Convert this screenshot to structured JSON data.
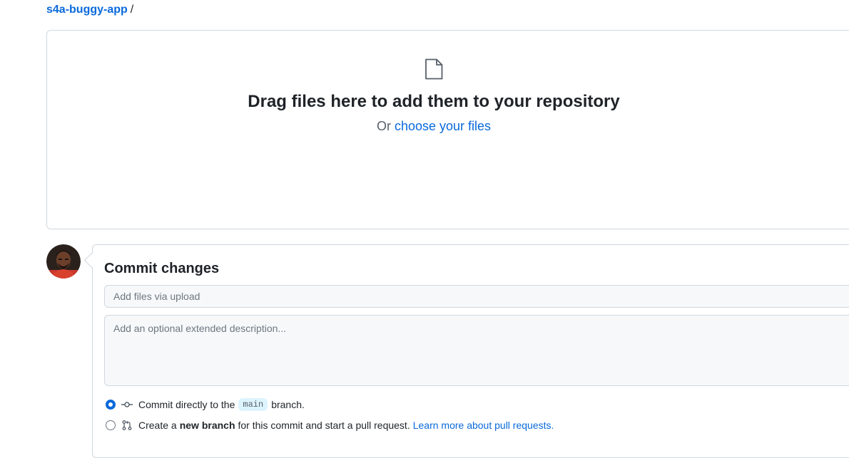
{
  "breadcrumb": {
    "repo": "s4a-buggy-app",
    "separator": "/"
  },
  "dropzone": {
    "title": "Drag files here to add them to your repository",
    "or_text": "Or",
    "choose_link": "choose your files"
  },
  "commit": {
    "title": "Commit changes",
    "summary_placeholder": "Add files via upload",
    "summary_value": "",
    "description_placeholder": "Add an optional extended description...",
    "description_value": "",
    "options": [
      {
        "selected": true,
        "text_before": "Commit directly to the",
        "branch": "main",
        "text_after": "branch."
      },
      {
        "selected": false,
        "text_before": "Create a",
        "bold": "new branch",
        "text_after": "for this commit and start a pull request.",
        "link": "Learn more about pull requests."
      }
    ]
  },
  "colors": {
    "accent": "#0969da",
    "border": "#d0d7de",
    "input_bg": "#f6f8fa",
    "text": "#1f2328",
    "muted": "#57606a"
  },
  "icons": {
    "file": "file-icon",
    "commit": "git-commit-icon",
    "pull_request": "git-pull-request-icon",
    "avatar": "user-avatar"
  }
}
